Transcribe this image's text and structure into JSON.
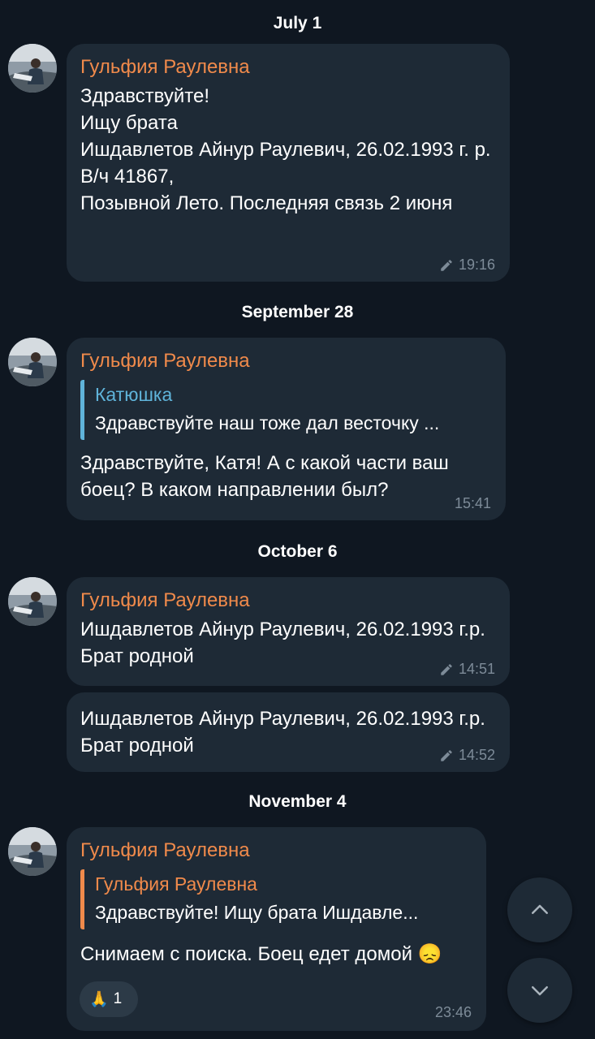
{
  "dates": [
    "July 1",
    "September 28",
    "October 6",
    "November 4"
  ],
  "sender_name": "Гульфия Раулевна",
  "messages": [
    {
      "sender": "Гульфия Раулевна",
      "text": "Здравствуйте!\nИщу брата\nИшдавлетов Айнур Раулевич, 26.02.1993 г. р.\nВ/ч 41867,\nПозывной Лето. Последняя связь 2 июня",
      "time": "19:16",
      "edited": true
    },
    {
      "sender": "Гульфия Раулевна",
      "reply": {
        "name": "Катюшка",
        "text": "Здравствуйте наш тоже дал весточку ..."
      },
      "text": "Здравствуйте, Катя! А с какой части ваш боец? В каком направлении был?",
      "time": "15:41",
      "edited": false
    },
    {
      "sender": "Гульфия Раулевна",
      "text": "Ишдавлетов Айнур Раулевич, 26.02.1993 г.р. Брат родной",
      "time": "14:51",
      "edited": true
    },
    {
      "text": "Ишдавлетов Айнур Раулевич, 26.02.1993 г.р. Брат родной",
      "time": "14:52",
      "edited": true
    },
    {
      "sender": "Гульфия Раулевна",
      "reply": {
        "name": "Гульфия Раулевна",
        "text": "Здравствуйте!  Ищу брата  Ишдавле..."
      },
      "text": "Снимаем с поиска. Боец едет домой 😞",
      "reaction": {
        "emoji": "🙏",
        "count": "1"
      },
      "time": "23:46",
      "edited": false
    }
  ],
  "colors": {
    "background": "#0f1721",
    "bubble": "#1e2a36",
    "sender": "#f08a4b",
    "reply_accent_blue": "#5fb3d9",
    "reply_accent_orange": "#f08a4b",
    "time": "#7d8b98"
  },
  "icons": {
    "edited": "pencil-icon",
    "scroll_up": "chevron-up-icon",
    "scroll_down": "chevron-down-icon"
  }
}
